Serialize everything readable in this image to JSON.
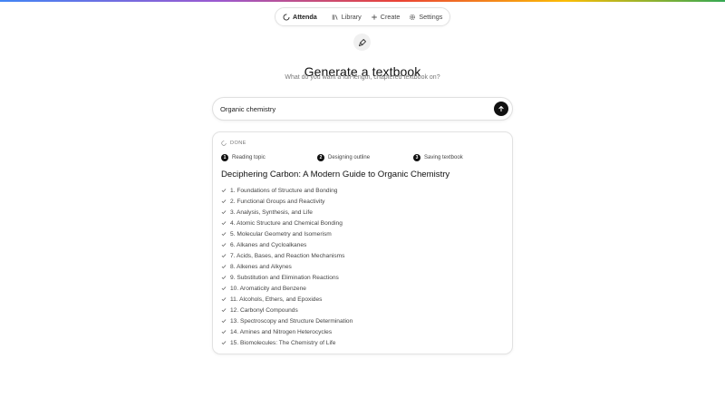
{
  "nav": {
    "brand": "Attenda",
    "items": [
      {
        "label": "Library",
        "icon": "library-icon"
      },
      {
        "label": "Create",
        "icon": "plus-icon"
      },
      {
        "label": "Settings",
        "icon": "gear-icon"
      }
    ]
  },
  "hero": {
    "icon": "pen-nib-icon",
    "title": "Generate a textbook",
    "subtitle": "What do you want a full-length, chaptered textbook on?"
  },
  "search": {
    "value": "Organic chemistry",
    "submit_icon": "arrow-up-icon"
  },
  "result": {
    "status": "DONE",
    "steps": [
      {
        "number": "1",
        "label": "Reading topic"
      },
      {
        "number": "2",
        "label": "Designing outline"
      },
      {
        "number": "3",
        "label": "Saving textbook"
      }
    ],
    "title": "Deciphering Carbon: A Modern Guide to Organic Chemistry",
    "chapters": [
      "1. Foundations of Structure and Bonding",
      "2. Functional Groups and Reactivity",
      "3. Analysis, Synthesis, and Life",
      "4. Atomic Structure and Chemical Bonding",
      "5. Molecular Geometry and Isomerism",
      "6. Alkanes and Cycloalkanes",
      "7. Acids, Bases, and Reaction Mechanisms",
      "8. Alkenes and Alkynes",
      "9. Substitution and Elimination Reactions",
      "10. Aromaticity and Benzene",
      "11. Alcohols, Ethers, and Epoxides",
      "12. Carbonyl Compounds",
      "13. Spectroscopy and Structure Determination",
      "14. Amines and Nitrogen Heterocycles",
      "15. Biomolecules: The Chemistry of Life"
    ]
  },
  "colors": {
    "accent": "#111111",
    "muted_text": "#777777",
    "border": "#e2e2e2"
  }
}
